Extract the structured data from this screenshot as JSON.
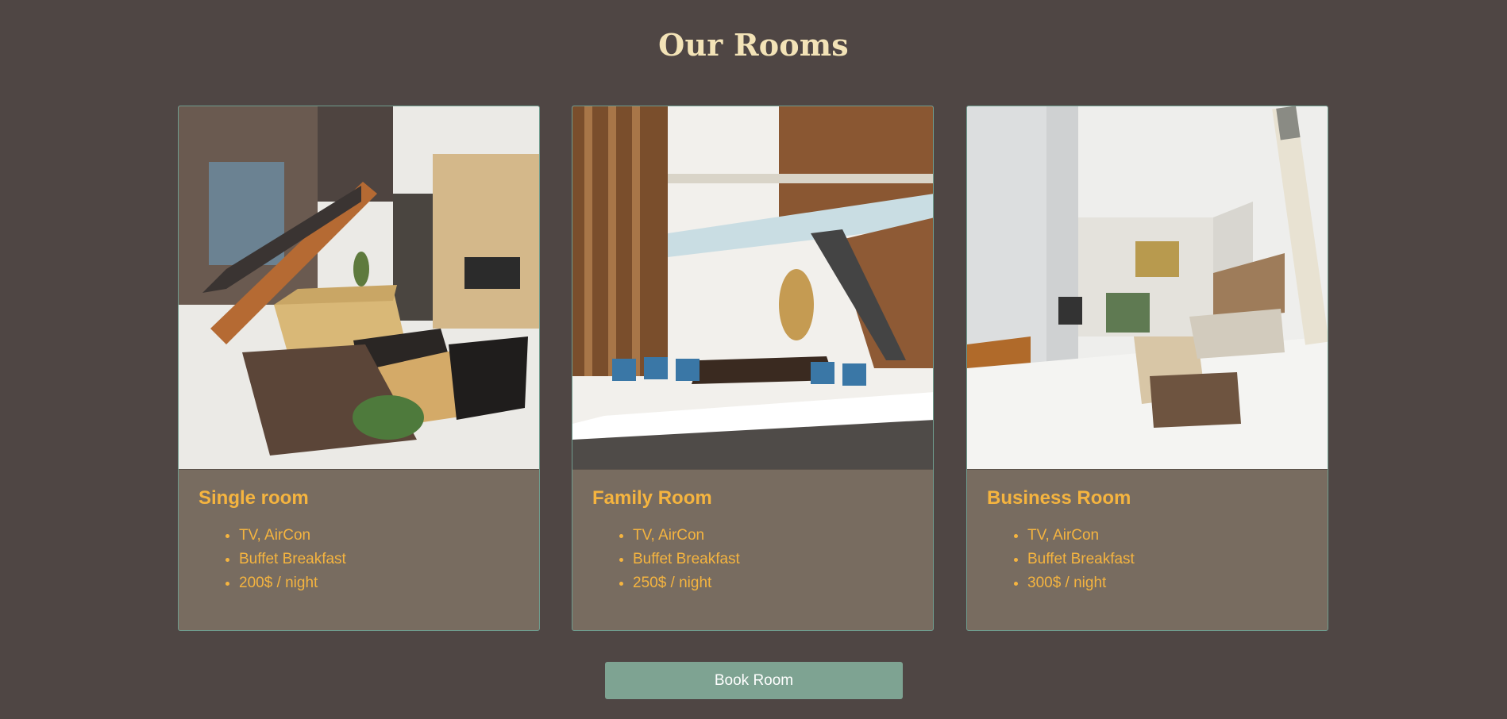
{
  "page": {
    "title": "Our Rooms"
  },
  "rooms": [
    {
      "title": "Single room",
      "features": [
        "TV, AirCon",
        "Buffet Breakfast",
        "200$ / night"
      ]
    },
    {
      "title": "Family Room",
      "features": [
        "TV, AirCon",
        "Buffet Breakfast",
        "250$ / night"
      ]
    },
    {
      "title": "Business Room",
      "features": [
        "TV, AirCon",
        "Buffet Breakfast",
        "300$ / night"
      ]
    }
  ],
  "actions": {
    "book_label": "Book Room"
  },
  "colors": {
    "background": "#4f4644",
    "card": "#786c60",
    "accent": "#f5b43f",
    "title": "#f3e3b7",
    "button": "#7ea392",
    "border": "#6f9c8e"
  }
}
